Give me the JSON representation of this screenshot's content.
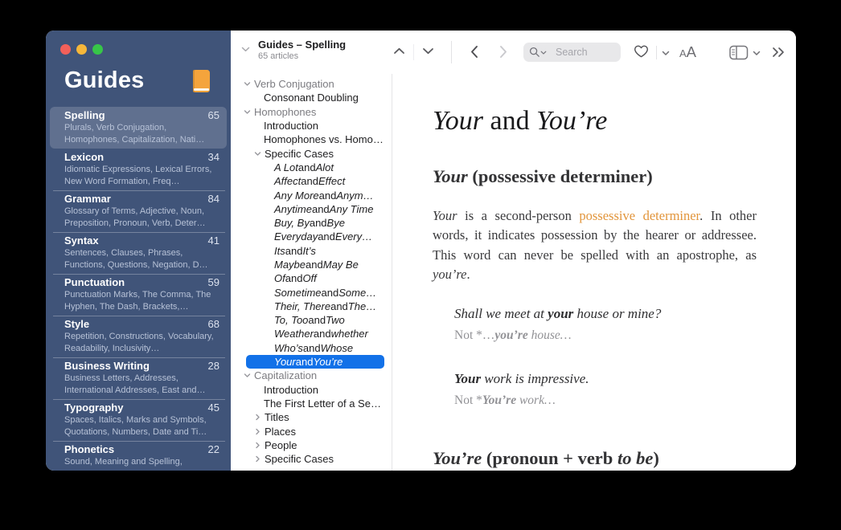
{
  "colors": {
    "sidebar_bg": "#405479",
    "accent_blue": "#1271e8",
    "link_orange": "#e2953b",
    "selected_row_text": "#ffffff"
  },
  "window_controls": {
    "close": "red",
    "minimize": "yellow",
    "zoom": "green"
  },
  "sidebar": {
    "title": "Guides",
    "icon": "orange-book-icon",
    "items": [
      {
        "title": "Spelling",
        "count": "65",
        "subtitle": "Plurals, Verb Conjugation, Homophones, Capitalization, Nati…",
        "selected": true
      },
      {
        "title": "Lexicon",
        "count": "34",
        "subtitle": "Idiomatic Expressions, Lexical Errors, New Word Formation, Freq…",
        "selected": false
      },
      {
        "title": "Grammar",
        "count": "84",
        "subtitle": "Glossary of Terms, Adjective, Noun, Preposition, Pronoun, Verb, Deter…",
        "selected": false
      },
      {
        "title": "Syntax",
        "count": "41",
        "subtitle": "Sentences, Clauses, Phrases, Functions, Questions, Negation, D…",
        "selected": false
      },
      {
        "title": "Punctuation",
        "count": "59",
        "subtitle": "Punctuation Marks, The Comma, The Hyphen, The Dash, Brackets,…",
        "selected": false
      },
      {
        "title": "Style",
        "count": "68",
        "subtitle": "Repetition, Constructions, Vocabulary, Readability, Inclusivity…",
        "selected": false
      },
      {
        "title": "Business Writing",
        "count": "28",
        "subtitle": "Business Letters, Addresses, International Addresses, East and…",
        "selected": false
      },
      {
        "title": "Typography",
        "count": "45",
        "subtitle": "Spaces, Italics, Marks and Symbols, Quotations, Numbers, Date and Ti…",
        "selected": false
      },
      {
        "title": "Phonetics",
        "count": "22",
        "subtitle": "Sound, Meaning and Spelling,",
        "selected": false
      }
    ]
  },
  "header": {
    "title": "Guides – Spelling",
    "subtitle": "65 articles"
  },
  "toolbar": {
    "search_placeholder": "Search",
    "text_size_small": "A",
    "text_size_large": "A",
    "icons": [
      "collapse-chevron",
      "previous-article-chevron-up",
      "next-article-chevron-down",
      "back-chevron",
      "forward-chevron",
      "magnifier",
      "search-scope-chevron",
      "heart-outline",
      "favorites-chevron",
      "text-size-AA",
      "layout-panel",
      "layout-chevron",
      "double-chevron-overflow"
    ]
  },
  "outline": {
    "items": [
      {
        "level": 0,
        "chevron": "down",
        "parts": [
          {
            "t": "Verb Conjugation"
          }
        ]
      },
      {
        "level": 1,
        "parts": [
          {
            "t": "Consonant Doubling"
          }
        ]
      },
      {
        "level": 0,
        "chevron": "down",
        "parts": [
          {
            "t": "Homophones"
          }
        ]
      },
      {
        "level": 1,
        "parts": [
          {
            "t": "Introduction"
          }
        ]
      },
      {
        "level": 1,
        "parts": [
          {
            "t": "Homophones vs. Homo…"
          }
        ]
      },
      {
        "level": 1,
        "chevron": "down",
        "parts": [
          {
            "t": "Specific Cases"
          }
        ]
      },
      {
        "level": 2,
        "parts": [
          {
            "t": "A Lot",
            "i": true
          },
          {
            "t": " and "
          },
          {
            "t": "Alot",
            "i": true
          }
        ]
      },
      {
        "level": 2,
        "parts": [
          {
            "t": "Affect",
            "i": true
          },
          {
            "t": " and "
          },
          {
            "t": "Effect",
            "i": true
          }
        ]
      },
      {
        "level": 2,
        "parts": [
          {
            "t": "Any More",
            "i": true
          },
          {
            "t": " and "
          },
          {
            "t": "Anym…",
            "i": true
          }
        ]
      },
      {
        "level": 2,
        "parts": [
          {
            "t": "Anytime",
            "i": true
          },
          {
            "t": " and "
          },
          {
            "t": "Any Time",
            "i": true
          }
        ]
      },
      {
        "level": 2,
        "parts": [
          {
            "t": "Buy, By",
            "i": true
          },
          {
            "t": " and "
          },
          {
            "t": "Bye",
            "i": true
          }
        ]
      },
      {
        "level": 2,
        "parts": [
          {
            "t": "Everyday",
            "i": true
          },
          {
            "t": " and "
          },
          {
            "t": "Every…",
            "i": true
          }
        ]
      },
      {
        "level": 2,
        "parts": [
          {
            "t": "Its",
            "i": true
          },
          {
            "t": " and "
          },
          {
            "t": "It’s",
            "i": true
          }
        ]
      },
      {
        "level": 2,
        "parts": [
          {
            "t": "Maybe",
            "i": true
          },
          {
            "t": " and "
          },
          {
            "t": "May Be",
            "i": true
          }
        ]
      },
      {
        "level": 2,
        "parts": [
          {
            "t": "Of",
            "i": true
          },
          {
            "t": " and "
          },
          {
            "t": "Off",
            "i": true
          }
        ]
      },
      {
        "level": 2,
        "parts": [
          {
            "t": "Sometime",
            "i": true
          },
          {
            "t": " and "
          },
          {
            "t": "Some…",
            "i": true
          }
        ]
      },
      {
        "level": 2,
        "parts": [
          {
            "t": "Their, There",
            "i": true
          },
          {
            "t": " and "
          },
          {
            "t": "The…",
            "i": true
          }
        ]
      },
      {
        "level": 2,
        "parts": [
          {
            "t": "To, Too",
            "i": true
          },
          {
            "t": " and "
          },
          {
            "t": "Two",
            "i": true
          }
        ]
      },
      {
        "level": 2,
        "parts": [
          {
            "t": "Weather",
            "i": true
          },
          {
            "t": " and "
          },
          {
            "t": "whether",
            "i": true
          }
        ]
      },
      {
        "level": 2,
        "parts": [
          {
            "t": "Who’s",
            "i": true
          },
          {
            "t": " and "
          },
          {
            "t": "Whose",
            "i": true
          }
        ]
      },
      {
        "level": 2,
        "selected": true,
        "parts": [
          {
            "t": "Your",
            "i": true
          },
          {
            "t": " and "
          },
          {
            "t": "You’re",
            "i": true
          }
        ]
      },
      {
        "level": 0,
        "chevron": "down",
        "parts": [
          {
            "t": "Capitalization"
          }
        ]
      },
      {
        "level": 1,
        "parts": [
          {
            "t": "Introduction"
          }
        ]
      },
      {
        "level": 1,
        "parts": [
          {
            "t": "The First Letter of a Se…"
          }
        ]
      },
      {
        "level": 1,
        "chevron": "right",
        "parts": [
          {
            "t": "Titles"
          }
        ]
      },
      {
        "level": 1,
        "chevron": "right",
        "parts": [
          {
            "t": "Places"
          }
        ]
      },
      {
        "level": 1,
        "chevron": "right",
        "parts": [
          {
            "t": "People"
          }
        ]
      },
      {
        "level": 1,
        "chevron": "right",
        "parts": [
          {
            "t": "Specific Cases"
          }
        ]
      }
    ]
  },
  "content": {
    "title": [
      {
        "t": "Your",
        "i": true
      },
      {
        "t": " and "
      },
      {
        "t": "You’re",
        "i": true
      }
    ],
    "heading1": [
      {
        "t": "Your",
        "i": true
      },
      {
        "t": " (possessive determiner)"
      }
    ],
    "paragraph1": [
      {
        "t": "Your",
        "i": true
      },
      {
        "t": " is a second-person "
      },
      {
        "t": "possessive determiner",
        "link": true
      },
      {
        "t": ". In other words, it indicates possession by the hearer or addressee. This word can never be spelled with an apostrophe, as "
      },
      {
        "t": "you’re",
        "i": true
      },
      {
        "t": "."
      }
    ],
    "example1": {
      "main": [
        {
          "t": "Shall we meet at ",
          "i": true
        },
        {
          "t": "your",
          "i": true,
          "b": true
        },
        {
          "t": " house or mine?",
          "i": true
        }
      ],
      "note": [
        {
          "t": "Not *…"
        },
        {
          "t": "you’re",
          "i": true,
          "b": true
        },
        {
          "t": " house",
          "i": true
        },
        {
          "t": "…",
          "i": true
        }
      ]
    },
    "example2": {
      "main": [
        {
          "t": "Your",
          "i": true,
          "b": true
        },
        {
          "t": " work is impressive.",
          "i": true
        }
      ],
      "note": [
        {
          "t": "Not *"
        },
        {
          "t": "You’re",
          "i": true,
          "b": true
        },
        {
          "t": " work",
          "i": true
        },
        {
          "t": "…",
          "i": true
        }
      ]
    },
    "heading2": [
      {
        "t": "You’re",
        "i": true
      },
      {
        "t": " (pronoun + verb "
      },
      {
        "t": "to be",
        "i": true
      },
      {
        "t": ")"
      }
    ]
  }
}
